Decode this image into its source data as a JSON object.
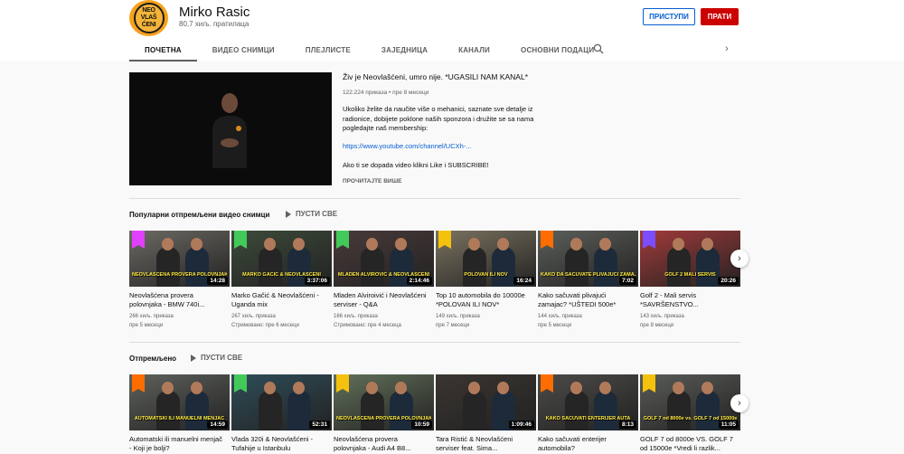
{
  "channel": {
    "name": "Mirko Rasic",
    "subscribers": "80,7 хиљ. пратилаца",
    "avatar_text": [
      "NEO",
      "VLAŠ",
      "ĆENI"
    ]
  },
  "buttons": {
    "join": "ПРИСТУПИ",
    "subscribe": "ПРАТИ"
  },
  "tabs": [
    "ПОЧЕТНА",
    "ВИДЕО СНИМЦИ",
    "ПЛЕЈЛИСТЕ",
    "ЗАЈЕДНИЦА",
    "КАНАЛИ",
    "ОСНОВНИ ПОДАЦИ"
  ],
  "featured": {
    "title": "Živ je Neovlašćeni, umro nije. *UGASILI NAM KANAL*",
    "meta": "122.224 приказа • пре 8 месеци",
    "description": "Ukoliko želite da naučite više o mehanici, saznate sve detalje iz radionice, dobijete poklone naših sponzora i družite se sa nama pogledajte naš membership:",
    "link": "https://www.youtube.com/channel/UCXh-...",
    "cta": "Ako ti se dopada video klikni Like i SUBSCRIBE!",
    "read_more": "ПРОЧИТАЈТЕ ВИШЕ"
  },
  "shelves": [
    {
      "title": "Популарни отпремљени видео снимци",
      "play_all": "ПУСТИ СВЕ",
      "videos": [
        {
          "title": "Neovlašćena provera polovnjaka - BMW 740i...",
          "duration": "14:28",
          "views": "266 хиљ. приказа",
          "age": "пре 5 месеци",
          "caption": "NEOVLAŠĆENA PROVERA POLOVNJAKA",
          "bg": "#6d6a63",
          "badge": "#e040fb"
        },
        {
          "title": "Marko Gačić & Neovlašćeni - Uganda mix",
          "duration": "3:37:06",
          "views": "267 хиљ. приказа",
          "age": "Стримовано: пре 6 месеци",
          "caption": "MARKO GAČIĆ & NEOVLAŠĆENI",
          "bg": "#3d4a3a",
          "badge": "#43c95a"
        },
        {
          "title": "Mladen Alviroivić i Neovlašćeni serviser - Q&A",
          "duration": "2:14:46",
          "views": "166 хиљ. приказа",
          "age": "Стримовано: пре 4 месеца",
          "caption": "MLADEN ALVIROVIĆ & NEOVLAŠĆENI",
          "bg": "#4a3a3a",
          "badge": "#43c95a"
        },
        {
          "title": "Top 10 automobila do 10000e *POLOVAN ILI NOV*",
          "duration": "16:24",
          "views": "149 хиљ. приказа",
          "age": "пре 7 месеци",
          "caption": "POLOVAN ILI NOV",
          "bg": "#7b7360",
          "badge": "#f4c20d"
        },
        {
          "title": "Kako sačuvati plivajući zamajac? *UŠTEDI 500e*",
          "duration": "7:02",
          "views": "144 хиљ. приказа",
          "age": "пре 5 месеци",
          "caption": "KAKO DA SAČUVATE PLIVAJUĆI ZAMAJAC",
          "bg": "#5c5f5a",
          "badge": "#ff6d00"
        },
        {
          "title": "Golf 2 - Mali servis *SAVRŠENSTVO...",
          "duration": "20:26",
          "views": "143 хиљ. приказа",
          "age": "пре 8 месеци",
          "caption": "GOLF 2 MALI SERVIS",
          "bg": "#a23a3a",
          "badge": "#7c4dff"
        }
      ]
    },
    {
      "title": "Отпремљено",
      "play_all": "ПУСТИ СВЕ",
      "videos": [
        {
          "title": "Automatski ili manuelni menjač - Koji je bolji?",
          "duration": "14:59",
          "views": "",
          "age": "",
          "caption": "AUTOMATSKI ILI MANUELNI MENJAČ",
          "bg": "#5e615c",
          "badge": "#ff6d00"
        },
        {
          "title": "Vlada 320i & Neovlašćeni - Tufahije u Istanbulu",
          "duration": "52:31",
          "views": "",
          "age": "",
          "caption": "",
          "bg": "#2f4d59",
          "badge": "#43c95a"
        },
        {
          "title": "Neovlašćena provera polovnjaka - Audi A4 B8...",
          "duration": "10:59",
          "views": "",
          "age": "",
          "caption": "NEOVLAŠĆENA PROVERA POLOVNJAKA",
          "bg": "#62705a",
          "badge": "#f4c20d"
        },
        {
          "title": "Tara Ristić & Neovlašćeni serviser feat. Sima...",
          "duration": "1:09:46",
          "views": "",
          "age": "",
          "caption": "",
          "bg": "#3a3530",
          "badge": ""
        },
        {
          "title": "Kako sačuvati enterijer automobila?",
          "duration": "8:13",
          "views": "",
          "age": "",
          "caption": "KAKO SAČUVATI ENTERIJER AUTA",
          "bg": "#4c4b48",
          "badge": "#ff6d00"
        },
        {
          "title": "GOLF 7 od 8000e VS. GOLF 7 od 15000e *Vredi li razlik...",
          "duration": "11:05",
          "views": "",
          "age": "",
          "caption": "GOLF 7 od 8000e vs. GOLF 7 od 15000e",
          "bg": "#5a5c58",
          "badge": "#f4c20d"
        }
      ]
    }
  ]
}
